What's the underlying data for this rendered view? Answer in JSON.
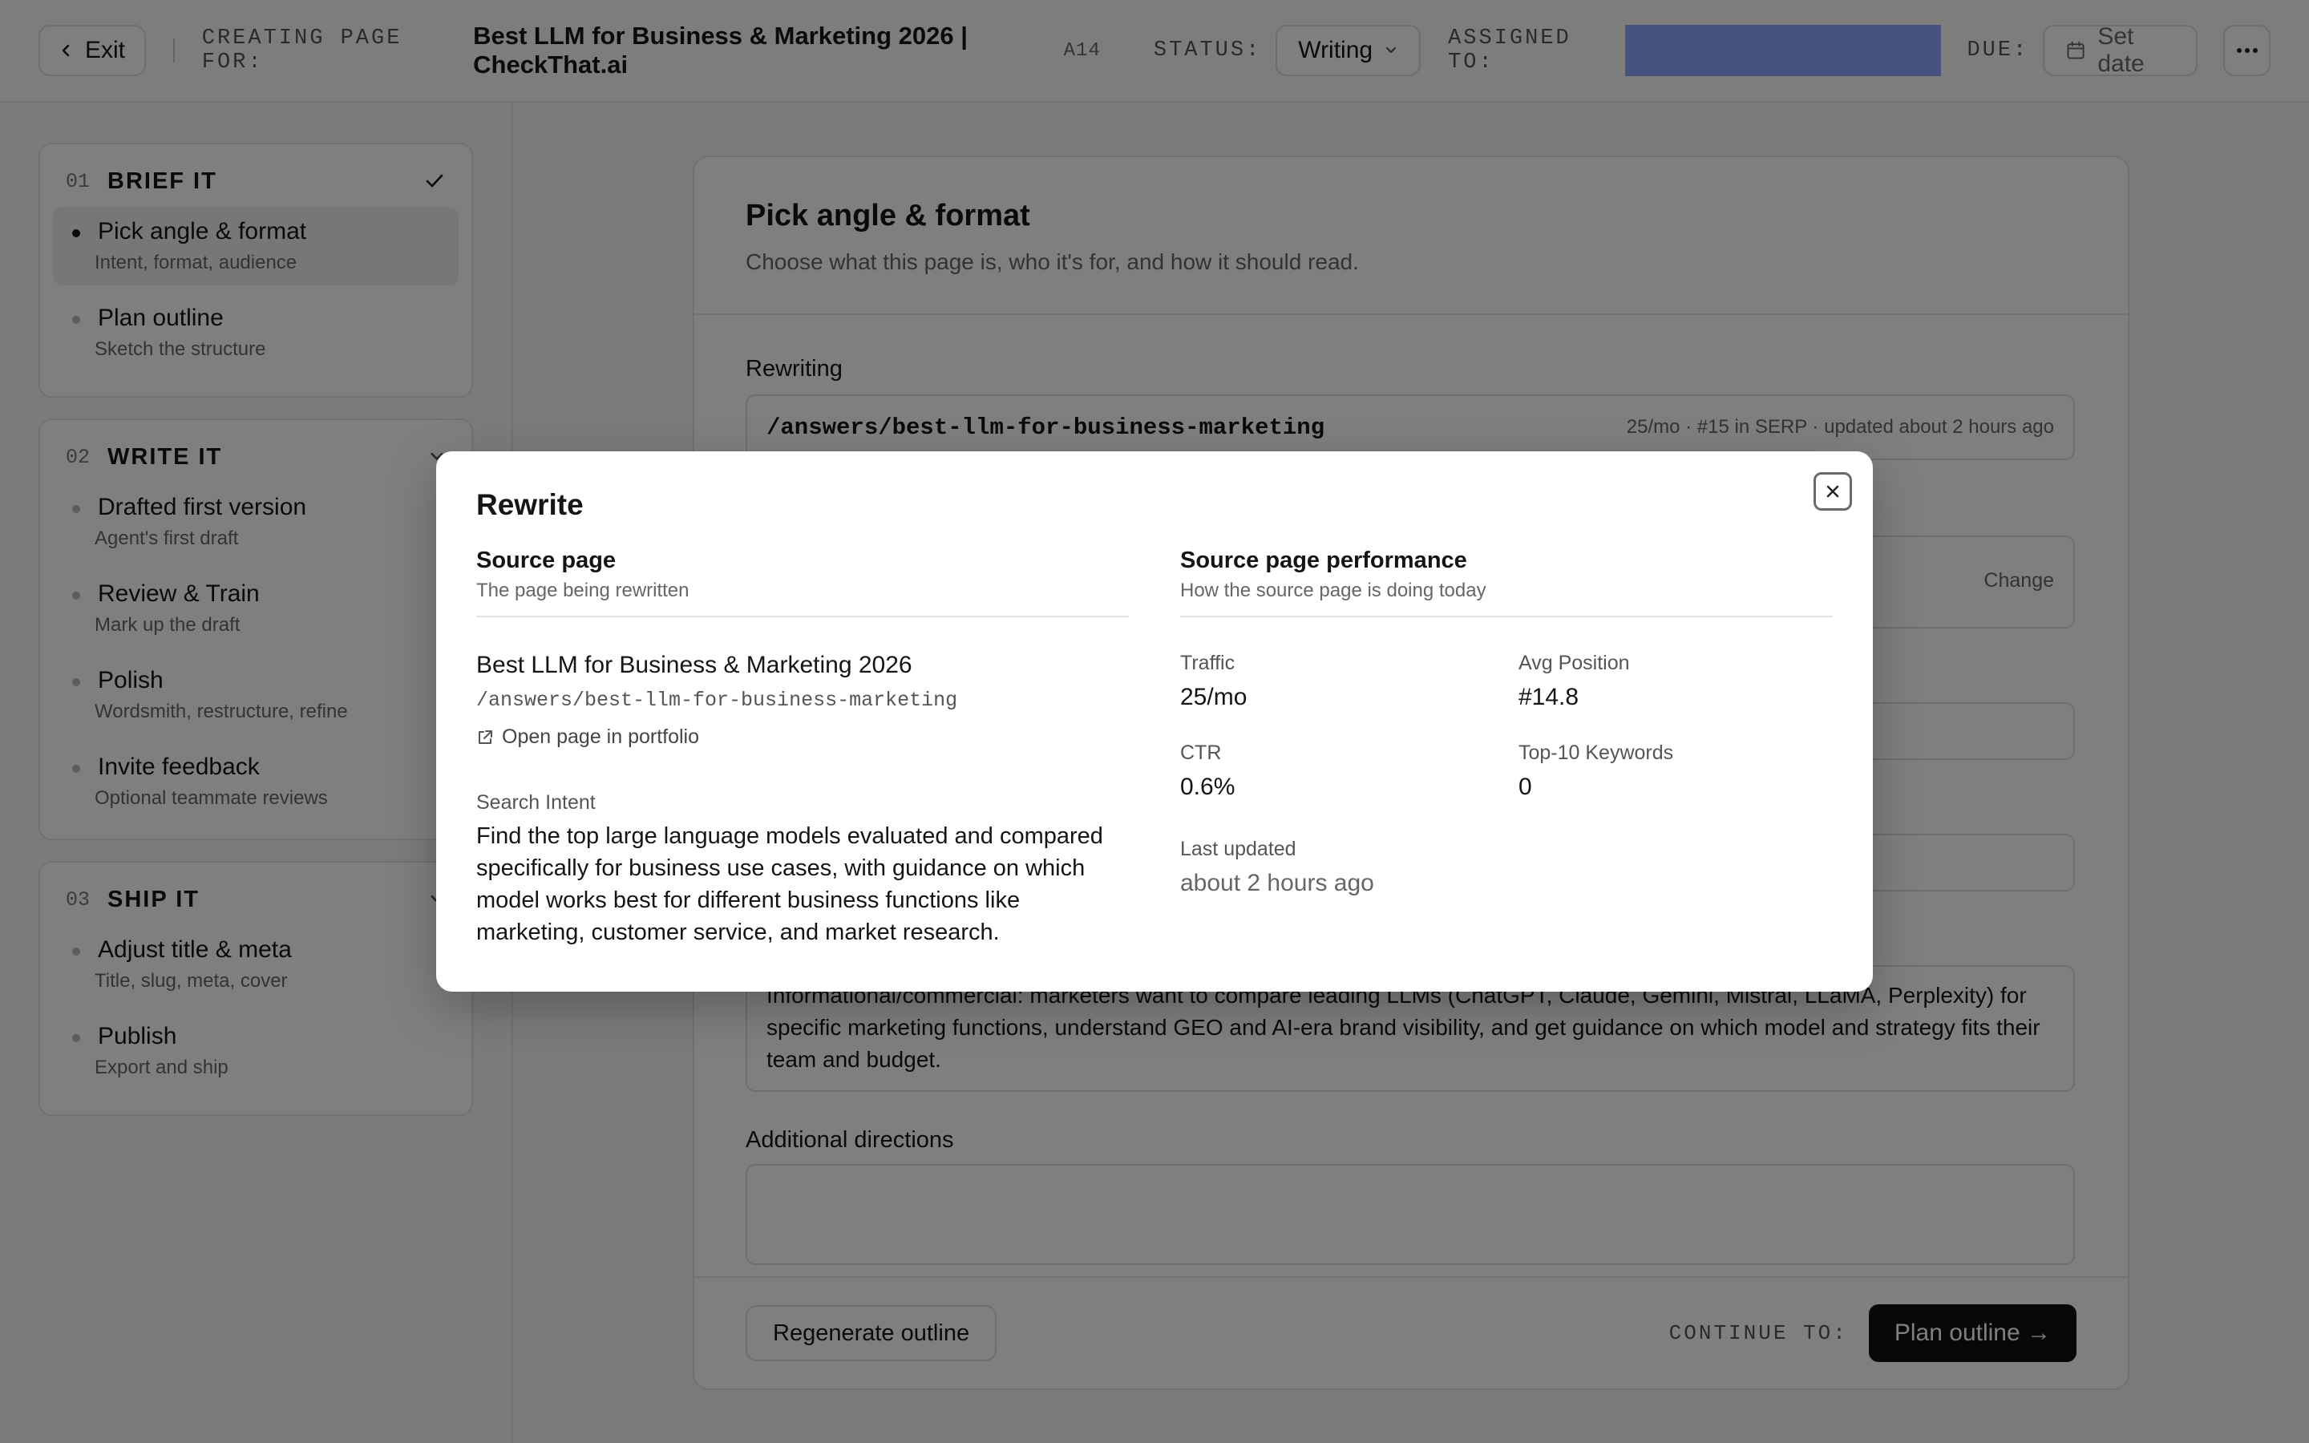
{
  "topbar": {
    "exit_label": "Exit",
    "creating_label": "CREATING PAGE FOR:",
    "page_title": "Best LLM for Business & Marketing 2026 | CheckThat.ai",
    "page_code": "A14",
    "status_label": "STATUS:",
    "status_value": "Writing",
    "assigned_label": "ASSIGNED TO:",
    "due_label": "DUE:",
    "due_button": "Set date"
  },
  "sidebar": {
    "sections": [
      {
        "num": "01",
        "title": "BRIEF IT",
        "steps": [
          {
            "label": "Pick angle & format",
            "sub": "Intent, format, audience"
          },
          {
            "label": "Plan outline",
            "sub": "Sketch the structure"
          }
        ]
      },
      {
        "num": "02",
        "title": "WRITE IT",
        "steps": [
          {
            "label": "Drafted first version",
            "sub": "Agent's first draft"
          },
          {
            "label": "Review & Train",
            "sub": "Mark up the draft"
          },
          {
            "label": "Polish",
            "sub": "Wordsmith, restructure, refine"
          },
          {
            "label": "Invite feedback",
            "sub": "Optional teammate reviews"
          }
        ]
      },
      {
        "num": "03",
        "title": "SHIP IT",
        "steps": [
          {
            "label": "Adjust title & meta",
            "sub": "Title, slug, meta, cover"
          },
          {
            "label": "Publish",
            "sub": "Export and ship"
          }
        ]
      }
    ]
  },
  "main": {
    "title": "Pick angle & format",
    "description": "Choose what this page is, who it's for, and how it should read.",
    "rewriting_label": "Rewriting",
    "rewriting_path": "/answers/best-llm-for-business-marketing",
    "rewriting_meta": "25/mo  ·  #15 in SERP  ·  updated about 2 hours ago",
    "change_label": "Change",
    "intent_text": "Informational/commercial: marketers want to compare leading LLMs (ChatGPT, Claude, Gemini, Mistral, LLaMA, Perplexity) for specific marketing functions, understand GEO and AI-era brand visibility, and get guidance on which model and strategy fits their team and budget.",
    "additional_label": "Additional directions",
    "regenerate_label": "Regenerate outline",
    "continue_label": "CONTINUE TO:",
    "continue_button": "Plan outline →"
  },
  "modal": {
    "title": "Rewrite",
    "source": {
      "heading": "Source page",
      "sub": "The page being rewritten",
      "page_title": "Best LLM for Business & Marketing 2026",
      "path": "/answers/best-llm-for-business-marketing",
      "open_link": "Open page in portfolio",
      "intent_label": "Search Intent",
      "intent_text": "Find the top large language models evaluated and compared specifically for business use cases, with guidance on which model works best for different business functions like marketing, customer service, and market research."
    },
    "performance": {
      "heading": "Source page performance",
      "sub": "How the source page is doing today",
      "traffic_label": "Traffic",
      "traffic_value": "25/mo",
      "avgpos_label": "Avg Position",
      "avgpos_value": "#14.8",
      "ctr_label": "CTR",
      "ctr_value": "0.6%",
      "top10_label": "Top-10 Keywords",
      "top10_value": "0",
      "updated_label": "Last updated",
      "updated_value": "about 2 hours ago"
    }
  }
}
